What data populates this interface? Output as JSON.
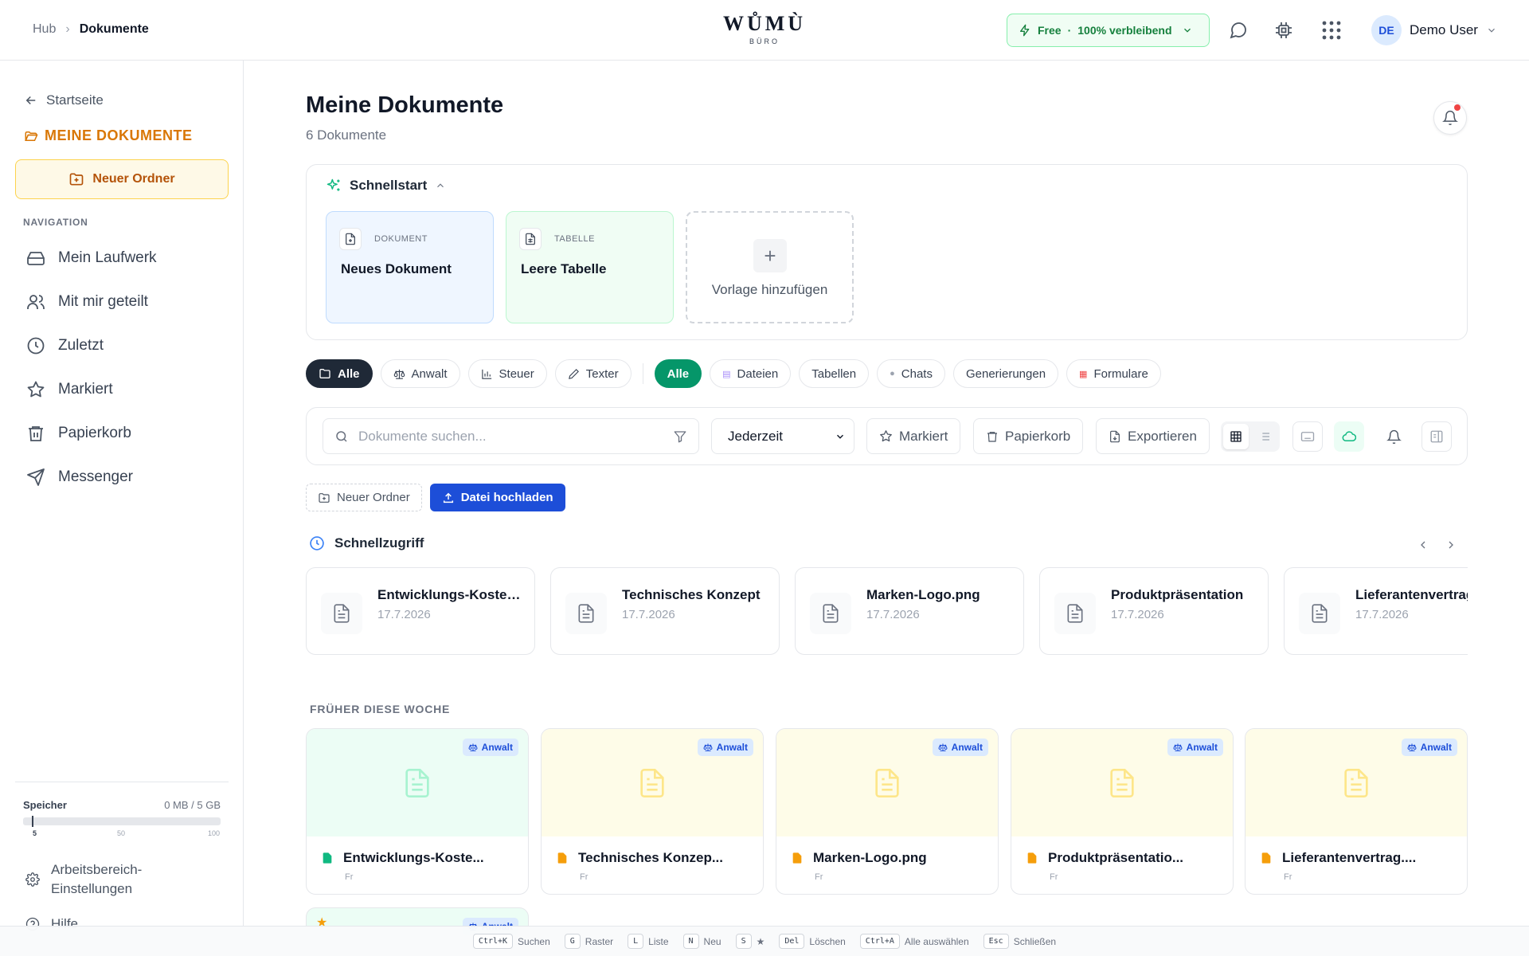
{
  "header": {
    "breadcrumb": [
      "Hub",
      "Dokumente"
    ],
    "breadcrumb_sep": "›",
    "logo": {
      "main": "WŮMÙ",
      "sub": "BÜRO"
    },
    "plan": {
      "name": "Free",
      "separator": "·",
      "status": "100% verbleibend"
    },
    "user": {
      "initials": "DE",
      "name": "Demo User"
    },
    "icons": [
      "chat-icon",
      "chip-icon",
      "apps-grid-icon"
    ]
  },
  "sidebar": {
    "back_label": "Startseite",
    "section_title": "MEINE DOKUMENTE",
    "new_folder": "Neuer Ordner",
    "nav_heading": "NAVIGATION",
    "nav_items": [
      {
        "label": "Mein Laufwerk",
        "icon": "drive-icon"
      },
      {
        "label": "Mit mir geteilt",
        "icon": "users-icon"
      },
      {
        "label": "Zuletzt",
        "icon": "clock-icon"
      },
      {
        "label": "Markiert",
        "icon": "star-icon"
      },
      {
        "label": "Papierkorb",
        "icon": "trash-icon"
      },
      {
        "label": "Messenger",
        "icon": "send-icon"
      }
    ],
    "storage": {
      "label": "Speicher",
      "value": "0 MB / 5 GB",
      "used_fraction": 0.0,
      "ticks": [
        "5",
        "50",
        "100"
      ]
    },
    "settings": "Arbeitsbereich-Einstellungen",
    "help": "Hilfe"
  },
  "main": {
    "title": "Meine Dokumente",
    "count": "6 Dokumente",
    "quickstart": {
      "title": "Schnellstart",
      "templates": [
        {
          "type": "DOKUMENT",
          "name": "Neues Dokument"
        },
        {
          "type": "TABELLE",
          "name": "Leere Tabelle"
        }
      ],
      "add_label": "Vorlage hinzufügen"
    },
    "category_chips": [
      {
        "label": "Alle",
        "icon": "folder-icon"
      },
      {
        "label": "Anwalt",
        "icon": "scale-icon"
      },
      {
        "label": "Steuer",
        "icon": "bar-chart-icon"
      },
      {
        "label": "Texter",
        "icon": "pen-icon"
      }
    ],
    "type_chips": [
      {
        "label": "Alle"
      },
      {
        "label": "Dateien",
        "icon": "doc-emoji-icon"
      },
      {
        "label": "Tabellen"
      },
      {
        "label": "Chats",
        "icon": "speech-emoji-icon"
      },
      {
        "label": "Generierungen"
      },
      {
        "label": "Formulare",
        "icon": "clipboard-emoji-icon"
      }
    ],
    "toolbar": {
      "search_placeholder": "Dokumente suchen...",
      "time_filter": "Jederzeit",
      "starred": "Markiert",
      "trash": "Papierkorb",
      "export": "Exportieren"
    },
    "actions": {
      "new_folder": "Neuer Ordner",
      "upload": "Datei hochladen"
    },
    "quick_access": {
      "title": "Schnellzugriff",
      "items": [
        {
          "name": "Entwicklungs-Kostenplan",
          "date": "17.7.2026"
        },
        {
          "name": "Technisches Konzept",
          "date": "17.7.2026"
        },
        {
          "name": "Marken-Logo.png",
          "date": "17.7.2026"
        },
        {
          "name": "Produktpräsentation",
          "date": "17.7.2026"
        },
        {
          "name": "Lieferantenvertrag",
          "date": "17.7.2026"
        }
      ]
    },
    "earlier_section": {
      "label": "FRÜHER DIESE WOCHE",
      "cards": [
        {
          "name": "Entwicklungs-Koste...",
          "tag": "Anwalt",
          "meta": "Fr",
          "color": "green"
        },
        {
          "name": "Technisches Konzep...",
          "tag": "Anwalt",
          "meta": "Fr",
          "color": "yellow"
        },
        {
          "name": "Marken-Logo.png",
          "tag": "Anwalt",
          "meta": "Fr",
          "color": "yellow"
        },
        {
          "name": "Produktpräsentatio...",
          "tag": "Anwalt",
          "meta": "Fr",
          "color": "yellow"
        },
        {
          "name": "Lieferantenvertrag....",
          "tag": "Anwalt",
          "meta": "Fr",
          "color": "yellow"
        }
      ],
      "peek_tag": "Anwalt"
    }
  },
  "shortcuts": [
    {
      "key": "Ctrl+K",
      "label": "Suchen"
    },
    {
      "key": "G",
      "label": "Raster"
    },
    {
      "key": "L",
      "label": "Liste"
    },
    {
      "key": "N",
      "label": "Neu"
    },
    {
      "key": "S",
      "label": "★"
    },
    {
      "key": "Del",
      "label": "Löschen"
    },
    {
      "key": "Ctrl+A",
      "label": "Alle auswählen"
    },
    {
      "key": "Esc",
      "label": "Schließen"
    }
  ],
  "colors": {
    "accent_orange": "#d97706",
    "primary_blue": "#1d4ed8",
    "success_green": "#059669",
    "tag_blue": "#dbeafe"
  }
}
